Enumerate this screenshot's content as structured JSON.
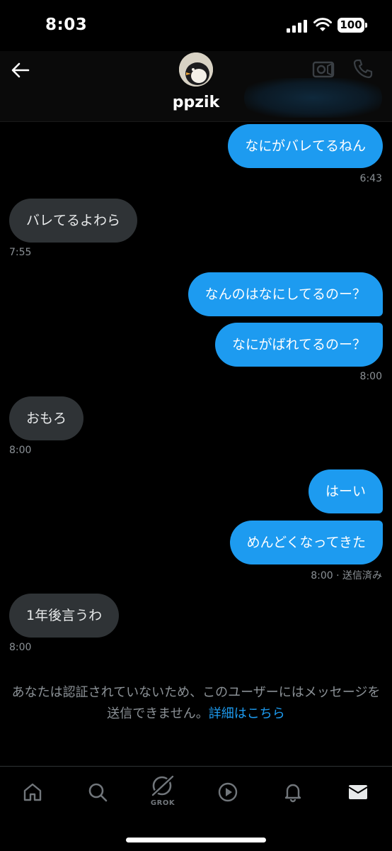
{
  "status_bar": {
    "time": "8:03",
    "battery": "100"
  },
  "header": {
    "username": "ppzik",
    "back_icon": "arrow-left-icon",
    "video_icon": "video-camera-icon",
    "call_icon": "phone-icon"
  },
  "messages": [
    {
      "direction": "out",
      "text": "なにがバレてるねん"
    },
    {
      "direction": "meta",
      "text": "6:43"
    },
    {
      "direction": "in",
      "text": "バレてるよわら"
    },
    {
      "direction": "meta",
      "text": "7:55"
    },
    {
      "direction": "out",
      "text": "なんのはなにしてるのー？"
    },
    {
      "direction": "out",
      "text": "なにがばれてるのー？"
    },
    {
      "direction": "meta",
      "text": "8:00"
    },
    {
      "direction": "in",
      "text": "おもろ"
    },
    {
      "direction": "meta",
      "text": "8:00"
    },
    {
      "direction": "out",
      "text": "はーい"
    },
    {
      "direction": "out",
      "text": "めんどくなってきた"
    },
    {
      "direction": "meta",
      "text": "8:00 · 送信済み"
    },
    {
      "direction": "in",
      "text": "1年後言うわ"
    },
    {
      "direction": "meta",
      "text": "8:00"
    }
  ],
  "notice": {
    "text": "あなたは認証されていないため、このユーザーにはメッセージを送信できません。",
    "link": "詳細はこちら"
  },
  "bottom_nav": {
    "grok_label": "GROK",
    "icons": [
      "home-icon",
      "search-icon",
      "grok-icon",
      "play-icon",
      "bell-icon",
      "mail-icon"
    ]
  },
  "colors": {
    "accent": "#1d9bf0",
    "incoming_bubble": "#2f3336",
    "background": "#000000",
    "muted_text": "#8b9196"
  }
}
